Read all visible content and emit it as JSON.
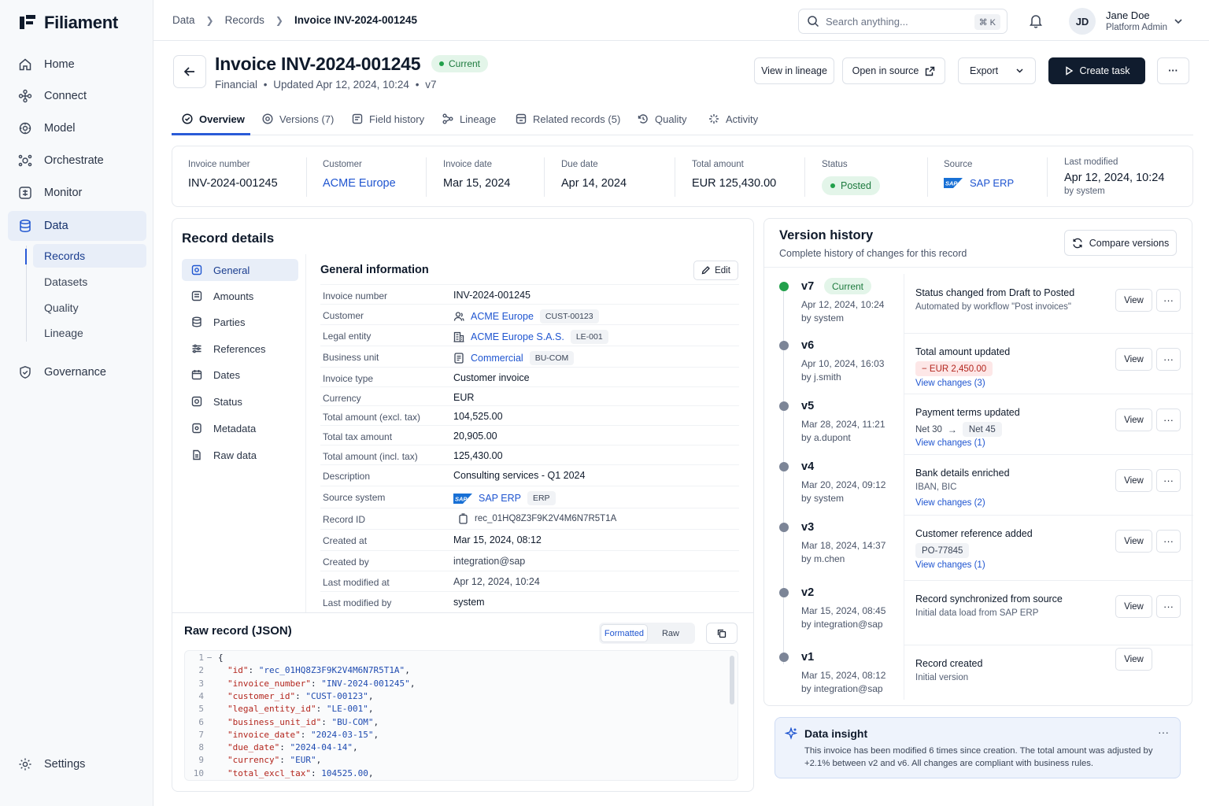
{
  "app": {
    "name": "Filiament"
  },
  "sidebar": {
    "items": [
      {
        "label": "Home",
        "icon": "home-icon"
      },
      {
        "label": "Connect",
        "icon": "connect-icon"
      },
      {
        "label": "Model",
        "icon": "model-icon"
      },
      {
        "label": "Orchestrate",
        "icon": "orchestrate-icon"
      },
      {
        "label": "Monitor",
        "icon": "monitor-icon"
      },
      {
        "label": "Data",
        "icon": "database-icon",
        "active": true
      },
      {
        "label": "Governance",
        "icon": "shield-icon"
      }
    ],
    "sub_items": [
      {
        "label": "Records",
        "active": true
      },
      {
        "label": "Datasets"
      },
      {
        "label": "Quality"
      },
      {
        "label": "Lineage"
      }
    ],
    "settings_label": "Settings"
  },
  "topbar": {
    "breadcrumbs": [
      "Data",
      "Records",
      "Invoice INV-2024-001245"
    ],
    "search_placeholder": "Search anything...",
    "search_shortcut": "⌘ K",
    "user": {
      "initials": "JD",
      "name": "Jane Doe",
      "role": "Platform Admin"
    }
  },
  "header": {
    "title": "Invoice INV-2024-001245",
    "badge": "Current",
    "subtitle_parts": [
      "Financial",
      "Updated Apr 12, 2024, 10:24",
      "v7"
    ],
    "buttons": {
      "lineage": "View in lineage",
      "source": "Open in source",
      "export": "Export",
      "create": "Create task",
      "more": "···"
    }
  },
  "tabs": [
    {
      "label": "Overview",
      "icon": "overview-icon",
      "active": true
    },
    {
      "label": "Versions (7)",
      "icon": "versions-icon"
    },
    {
      "label": "Field history",
      "icon": "field-history-icon"
    },
    {
      "label": "Lineage",
      "icon": "lineage-icon"
    },
    {
      "label": "Related records (5)",
      "icon": "related-icon"
    },
    {
      "label": "Quality",
      "icon": "quality-icon"
    },
    {
      "label": "Activity",
      "icon": "activity-icon"
    }
  ],
  "summary": {
    "invoice_number": {
      "label": "Invoice number",
      "value": "INV-2024-001245"
    },
    "customer": {
      "label": "Customer",
      "value": "ACME Europe"
    },
    "invoice_date": {
      "label": "Invoice date",
      "value": "Mar 15, 2024"
    },
    "due_date": {
      "label": "Due date",
      "value": "Apr 14, 2024"
    },
    "total_amount": {
      "label": "Total amount",
      "value": "EUR 125,430.00"
    },
    "status": {
      "label": "Status",
      "value": "Posted"
    },
    "source": {
      "label": "Source",
      "value": "SAP ERP",
      "logo": "SAP"
    },
    "last_modified": {
      "label": "Last modified",
      "value": "Apr 12, 2024, 10:24",
      "by": "by system"
    }
  },
  "record_details": {
    "title": "Record details",
    "sections": [
      {
        "label": "General",
        "icon": "general-icon",
        "active": true
      },
      {
        "label": "Amounts",
        "icon": "amounts-icon"
      },
      {
        "label": "Parties",
        "icon": "parties-icon"
      },
      {
        "label": "References",
        "icon": "references-icon"
      },
      {
        "label": "Dates",
        "icon": "calendar-icon"
      },
      {
        "label": "Status",
        "icon": "status-icon"
      },
      {
        "label": "Metadata",
        "icon": "metadata-icon"
      },
      {
        "label": "Raw data",
        "icon": "raw-data-icon"
      }
    ],
    "general_title": "General information",
    "edit_label": "Edit",
    "fields": {
      "invoice_number": {
        "label": "Invoice number",
        "value": "INV-2024-001245"
      },
      "customer": {
        "label": "Customer",
        "value": "ACME Europe",
        "chip": "CUST-00123"
      },
      "legal_entity": {
        "label": "Legal entity",
        "value": "ACME Europe S.A.S.",
        "chip": "LE-001"
      },
      "business_unit": {
        "label": "Business unit",
        "value": "Commercial",
        "chip": "BU-COM"
      },
      "invoice_type": {
        "label": "Invoice type",
        "value": "Customer invoice"
      },
      "currency": {
        "label": "Currency",
        "value": "EUR"
      },
      "total_excl": {
        "label": "Total amount (excl. tax)",
        "value": "104,525.00"
      },
      "total_tax": {
        "label": "Total tax amount",
        "value": "20,905.00"
      },
      "total_incl": {
        "label": "Total amount (incl. tax)",
        "value": "125,430.00"
      },
      "description": {
        "label": "Description",
        "value": "Consulting services - Q1 2024"
      },
      "source_system": {
        "label": "Source system",
        "value": "SAP ERP",
        "chip": "ERP",
        "logo": "SAP"
      },
      "record_id": {
        "label": "Record ID",
        "value": "rec_01HQ8Z3F9K2V4M6N7R5T1A"
      },
      "created_at": {
        "label": "Created at",
        "value": "Mar 15, 2024, 08:12"
      },
      "created_by": {
        "label": "Created by",
        "value": "integration@sap"
      },
      "last_modified_at": {
        "label": "Last modified at",
        "value": "Apr 12, 2024, 10:24"
      },
      "last_modified_by": {
        "label": "Last modified by",
        "value": "system"
      }
    }
  },
  "raw_json": {
    "title": "Raw record (JSON)",
    "toggle": {
      "formatted": "Formatted",
      "raw": "Raw"
    },
    "lines": [
      {
        "n": "1",
        "fold": "−",
        "key": "",
        "val": "",
        "open": "{"
      },
      {
        "n": "2",
        "key": "\"id\"",
        "val": "\"rec_01HQ8Z3F9K2V4M6N7R5T1A\""
      },
      {
        "n": "3",
        "key": "\"invoice_number\"",
        "val": "\"INV-2024-001245\""
      },
      {
        "n": "4",
        "key": "\"customer_id\"",
        "val": "\"CUST-00123\""
      },
      {
        "n": "5",
        "key": "\"legal_entity_id\"",
        "val": "\"LE-001\""
      },
      {
        "n": "6",
        "key": "\"business_unit_id\"",
        "val": "\"BU-COM\""
      },
      {
        "n": "7",
        "key": "\"invoice_date\"",
        "val": "\"2024-03-15\""
      },
      {
        "n": "8",
        "key": "\"due_date\"",
        "val": "\"2024-04-14\""
      },
      {
        "n": "9",
        "key": "\"currency\"",
        "val": "\"EUR\""
      },
      {
        "n": "10",
        "key": "\"total_excl_tax\"",
        "val": "104525.00"
      }
    ]
  },
  "version_history": {
    "title": "Version history",
    "subtitle": "Complete history of changes for this record",
    "compare_label": "Compare versions",
    "view_label": "View",
    "versions": [
      {
        "label": "v7",
        "badge": "Current",
        "date": "Apr 12, 2024, 10:24",
        "by": "by system",
        "title": "Status changed from Draft to Posted",
        "detail": "Automated by workflow \"Post invoices\""
      },
      {
        "label": "v6",
        "date": "Apr 10, 2024, 16:03",
        "by": "by j.smith",
        "title": "Total amount updated",
        "chip": "− EUR 2,450.00",
        "link": "View changes (3)"
      },
      {
        "label": "v5",
        "date": "Mar 28, 2024, 11:21",
        "by": "by a.dupont",
        "title": "Payment terms updated",
        "from": "Net 30",
        "to": "Net 45",
        "link": "View changes (1)"
      },
      {
        "label": "v4",
        "date": "Mar 20, 2024, 09:12",
        "by": "by system",
        "title": "Bank details enriched",
        "detail": "IBAN, BIC",
        "link": "View changes (2)"
      },
      {
        "label": "v3",
        "date": "Mar 18, 2024, 14:37",
        "by": "by m.chen",
        "title": "Customer reference added",
        "chip": "PO-77845",
        "link": "View changes (1)"
      },
      {
        "label": "v2",
        "date": "Mar 15, 2024, 08:45",
        "by": "by integration@sap",
        "title": "Record synchronized from source",
        "detail": "Initial data load from SAP ERP"
      },
      {
        "label": "v1",
        "date": "Mar 15, 2024, 08:12",
        "by": "by integration@sap",
        "title": "Record created",
        "detail": "Initial version"
      }
    ]
  },
  "insight": {
    "title": "Data insight",
    "body": "This invoice has been modified 6 times since creation. The total amount was adjusted by +2.1% between v2 and v6. All changes are compliant with business rules."
  },
  "colors": {
    "accent": "#2a5bd7",
    "primary_button": "#101c2e",
    "success": "#22a04b",
    "danger": "#b3261e"
  }
}
